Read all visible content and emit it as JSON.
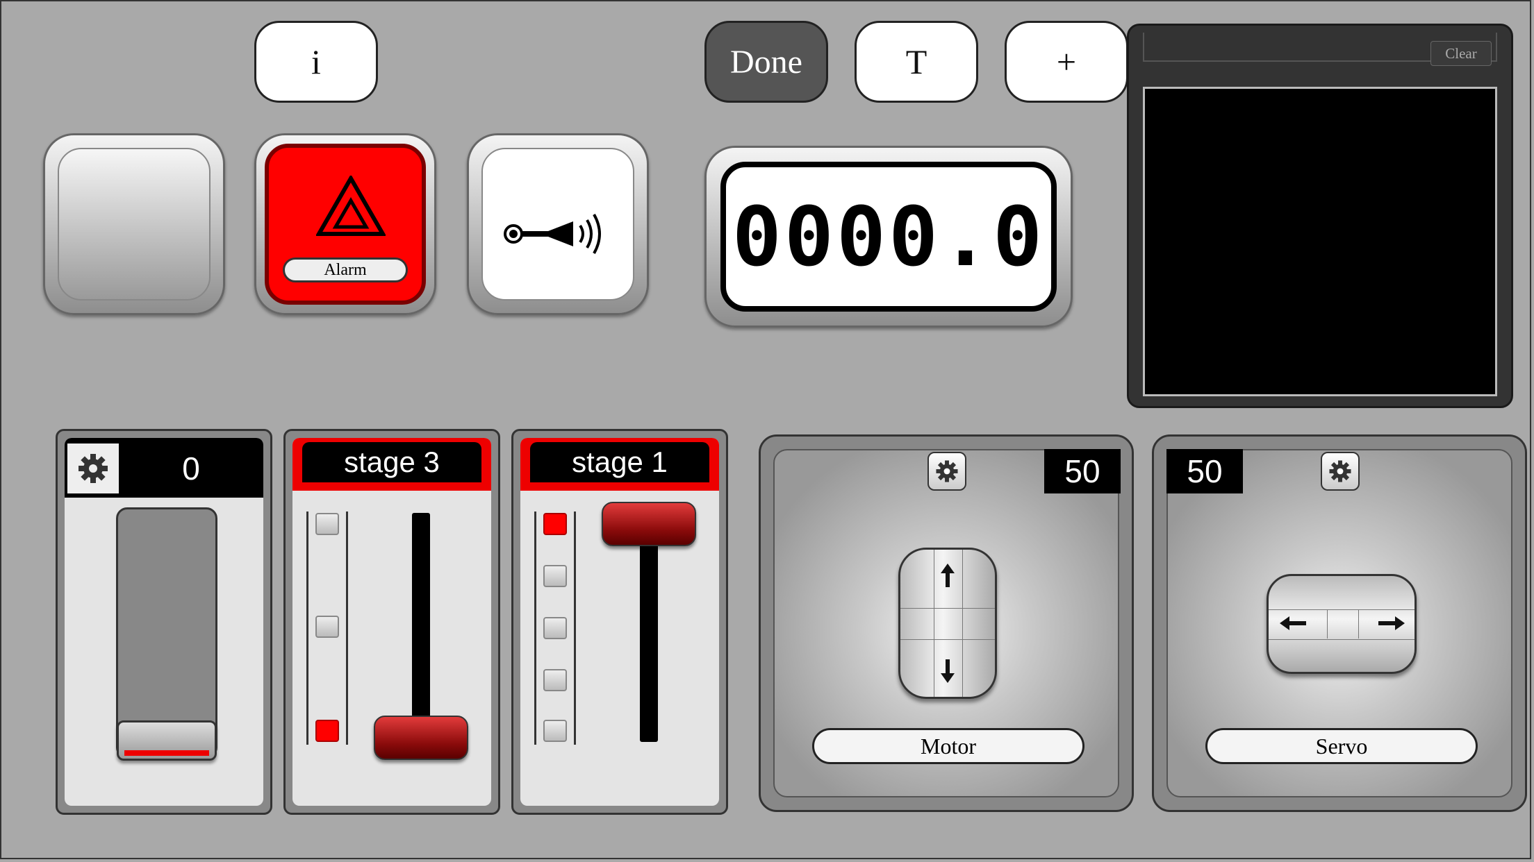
{
  "toolbar": {
    "info_label": "i",
    "done_label": "Done",
    "text_label": "T",
    "add_label": "+"
  },
  "buttons": {
    "alarm_label": "Alarm",
    "horn_icon": "horn-icon",
    "alarm_icon": "hazard-icon"
  },
  "display": {
    "value": "0000.0"
  },
  "console": {
    "clear_label": "Clear"
  },
  "slider": {
    "value": "0",
    "level": 0
  },
  "stage3": {
    "label": "stage 3",
    "leds": [
      false,
      true,
      false
    ],
    "current": 3
  },
  "stage1": {
    "label": "stage 1",
    "leds": [
      true,
      false,
      false,
      false,
      false
    ],
    "current": 1
  },
  "motor": {
    "value": "50",
    "label": "Motor"
  },
  "servo": {
    "value": "50",
    "label": "Servo"
  },
  "colors": {
    "accent": "#ff0000",
    "background": "#a9a9a9",
    "dark": "#333333"
  }
}
